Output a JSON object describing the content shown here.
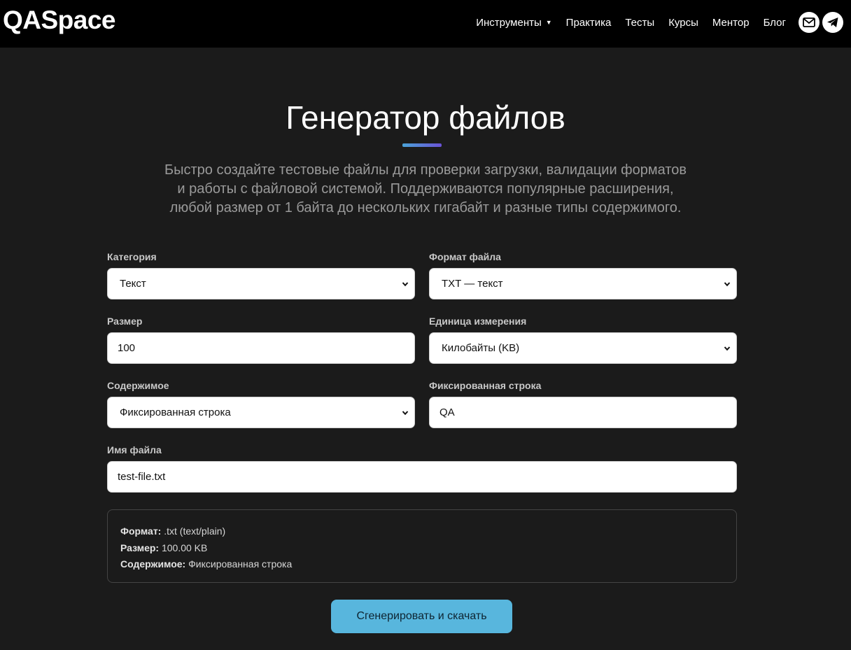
{
  "header": {
    "logo": "QASpace",
    "nav": [
      {
        "label": "Инструменты"
      },
      {
        "label": "Практика"
      },
      {
        "label": "Тесты"
      },
      {
        "label": "Курсы"
      },
      {
        "label": "Ментор"
      },
      {
        "label": "Блог"
      }
    ],
    "social_icons": [
      "mail-icon",
      "telegram-icon"
    ]
  },
  "page": {
    "title": "Генератор файлов",
    "lead_lines": [
      "Быстро создайте тестовые файлы для проверки загрузки, валидации форматов",
      "и работы с файловой системой. Поддерживаются популярные расширения,",
      "любой размер от 1 байта до нескольких гигабайт и разные типы содержимого."
    ]
  },
  "form": {
    "category": {
      "label": "Категория",
      "value": "Текст"
    },
    "format": {
      "label": "Формат файла",
      "value": "TXT — текст"
    },
    "size": {
      "label": "Размер",
      "value": "100"
    },
    "unit": {
      "label": "Единица измерения",
      "value": "Килобайты (KB)"
    },
    "content": {
      "label": "Содержимое",
      "value": "Фиксированная строка"
    },
    "fixed_string": {
      "label": "Фиксированная строка",
      "value": "QA"
    },
    "filename": {
      "label": "Имя файла",
      "value": "test-file.txt"
    }
  },
  "summary": {
    "format_label": "Формат:",
    "format_value": " .txt (text/plain)",
    "size_label": "Размер:",
    "size_value": " 100.00 KB",
    "content_label": "Содержимое:",
    "content_value": " Фиксированная строка"
  },
  "actions": {
    "generate_label": "Сгенерировать и скачать"
  },
  "colors": {
    "background": "#1b1b1b",
    "header": "#000000",
    "accent_button": "#58b6dd",
    "underline_start": "#4aa3d8",
    "underline_end": "#6a52d6"
  }
}
